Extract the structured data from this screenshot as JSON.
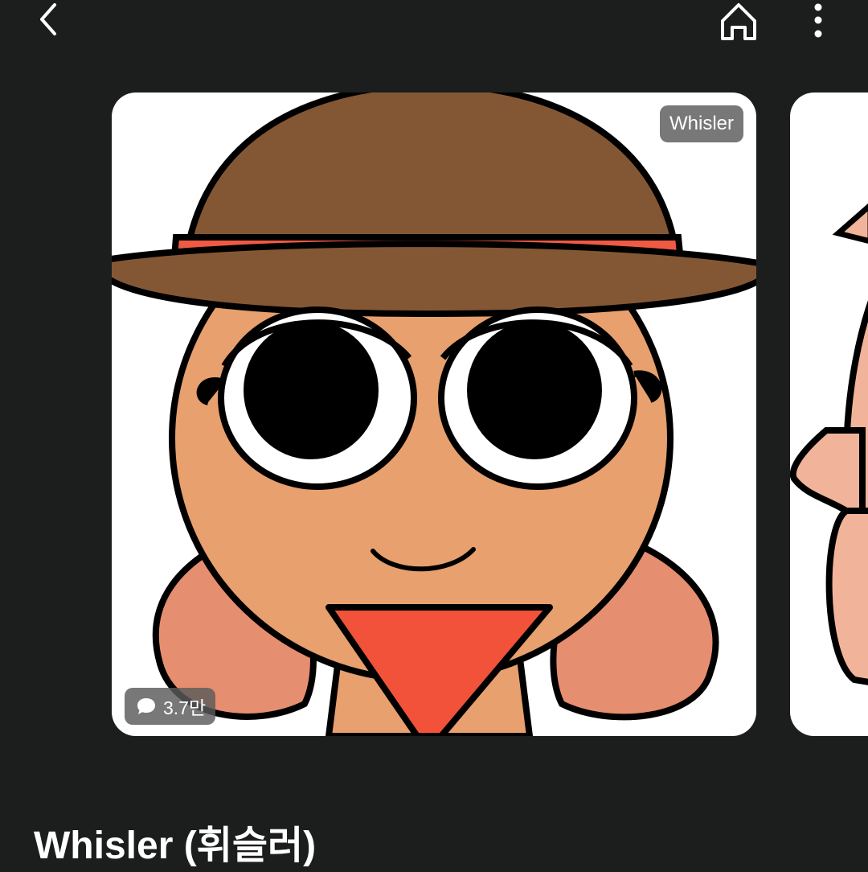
{
  "header": {
    "back_icon": "chevron-left-icon",
    "home_icon": "home-icon",
    "more_icon": "more-vertical-icon"
  },
  "carousel": {
    "main_card": {
      "name_badge": "Whisler",
      "comment_count": "3.7만",
      "comment_icon": "speech-bubble-icon"
    }
  },
  "character": {
    "title": "Whisler (휘슬러)"
  },
  "colors": {
    "background": "#1c1d1d",
    "hat": "#845734",
    "hat_band": "#f05a44",
    "skin": "#e7a06e",
    "pigtails": "#e68e70",
    "bandana": "#f2523a"
  }
}
